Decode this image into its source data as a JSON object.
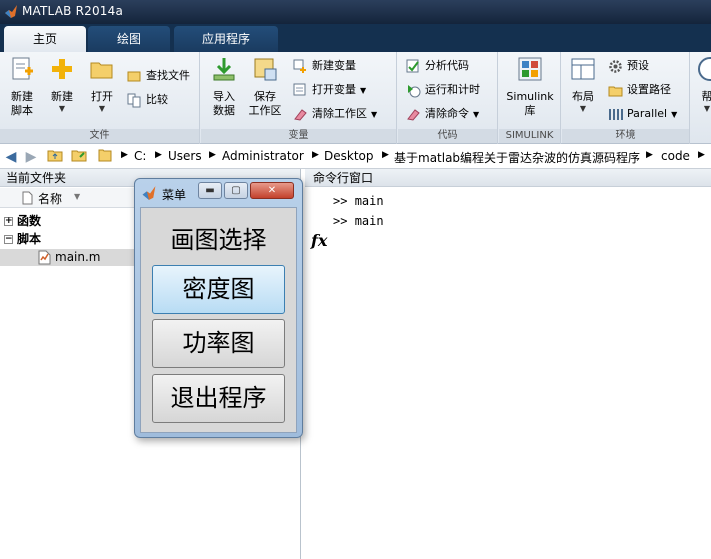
{
  "window": {
    "title": "MATLAB R2014a"
  },
  "tabs": [
    {
      "label": "主页"
    },
    {
      "label": "绘图"
    },
    {
      "label": "应用程序"
    }
  ],
  "ribbon": {
    "file": {
      "label": "文件",
      "new_script": "新建\n脚本",
      "new": "新建",
      "open": "打开",
      "find_files": "查找文件",
      "compare": "比较"
    },
    "variable": {
      "label": "变量",
      "import_data": "导入\n数据",
      "save_workspace": "保存\n工作区",
      "new_variable": "新建变量",
      "open_variable": "打开变量",
      "clear_workspace": "清除工作区"
    },
    "code": {
      "label": "代码",
      "analyze_code": "分析代码",
      "run_and_time": "运行和计时",
      "clear_commands": "清除命令"
    },
    "simulink": {
      "label": "SIMULINK",
      "library": "Simulink\n库"
    },
    "environment": {
      "label": "环境",
      "layout": "布局",
      "preferences": "预设",
      "set_path": "设置路径",
      "parallel": "Parallel"
    },
    "help": {
      "label": "帮"
    }
  },
  "address": {
    "crumbs": [
      "C:",
      "Users",
      "Administrator",
      "Desktop",
      "基于matlab编程关于雷达杂波的仿真源码程序",
      "code"
    ]
  },
  "file_browser": {
    "title": "当前文件夹",
    "column_name": "名称",
    "tree": [
      {
        "label": "函数",
        "expander": "+"
      },
      {
        "label": "脚本",
        "expander": "−"
      },
      {
        "label": "main.m"
      }
    ]
  },
  "command_window": {
    "title": "命令行窗口",
    "prompt": ">>",
    "lines": [
      "main",
      "main"
    ],
    "fx": "fx"
  },
  "menu_dialog": {
    "title": "菜单",
    "heading": "画图选择",
    "buttons": [
      {
        "label": "密度图"
      },
      {
        "label": "功率图"
      },
      {
        "label": "退出程序"
      }
    ]
  },
  "colors": {
    "titlebar": "#14243b",
    "tabstrip": "#14304f",
    "ribbon": "#e7ecf2",
    "dialog_frame": "#a9c4e2",
    "focused_button": "#b8dcf4"
  }
}
